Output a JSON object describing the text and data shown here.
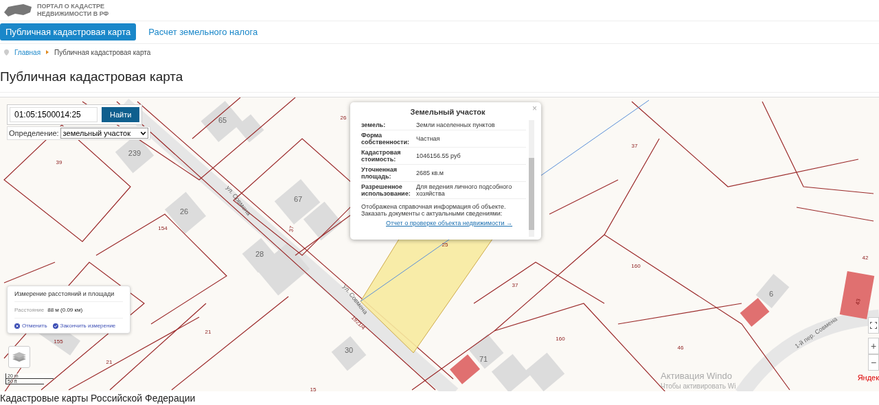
{
  "header": {
    "logo_line_1": "ПОРТАЛ О КАДАСТРЕ",
    "logo_line_2": "НЕДВИЖИМОСТИ В РФ"
  },
  "nav": [
    {
      "label": "Публичная кадастровая карта",
      "selected": true
    },
    {
      "label": "Расчет земельного налога",
      "selected": false
    }
  ],
  "breadcrumbs": [
    "Главная",
    "Публичная кадастровая карта"
  ],
  "page_title": "Публичная кадастровая карта",
  "map": {
    "search": {
      "value": "01:05:1500014:25",
      "button": "Найти"
    },
    "definition": {
      "label": "Определение:",
      "value": "земельный участок"
    },
    "labels": [
      "26",
      "65",
      "239",
      "39",
      "ул. Совмена",
      "67",
      "26",
      "154",
      "37",
      "28",
      "25",
      "37",
      "160",
      "37",
      "ул. Совмена",
      "1921/4",
      "21",
      "155",
      "21",
      "30",
      "71",
      "160",
      "46",
      "6",
      "42",
      "1-й пер. Совмена",
      "15",
      "43"
    ],
    "popup": {
      "title": "Земельный участок",
      "close": "×",
      "rows": [
        {
          "label": "земель:",
          "value": "Земли населенных пунктов"
        },
        {
          "label": "Форма собственности:",
          "value": "Частная"
        },
        {
          "label": "Кадастровая стоимость:",
          "value": "1046156.55 руб"
        },
        {
          "label": "Уточненная площадь:",
          "value": "2685 кв.м"
        },
        {
          "label": "Разрешенное использование:",
          "value": "Для ведения личного подсобного хозяйства"
        }
      ],
      "note": "Отображена справочная информация об объекте. Заказать документы с актуальными сведениями:",
      "link": "Отчет о проверке объекта недвижимости →"
    },
    "measure": {
      "title": "Измерение расстояний и площади",
      "distance_label": "Расстояние",
      "distance_value": "88 м (0.09 км)",
      "actions": [
        "Отменить",
        "Закончить измерение"
      ]
    },
    "scale": [
      "20 m",
      "50 ft"
    ],
    "zoom": [
      "+",
      "−"
    ],
    "attribution": "Яндек"
  },
  "os_notice": [
    "Активация Windo",
    "Чтобы активировать Wi"
  ],
  "bottom_heading": "Кадастровые карты Российской Федерации"
}
